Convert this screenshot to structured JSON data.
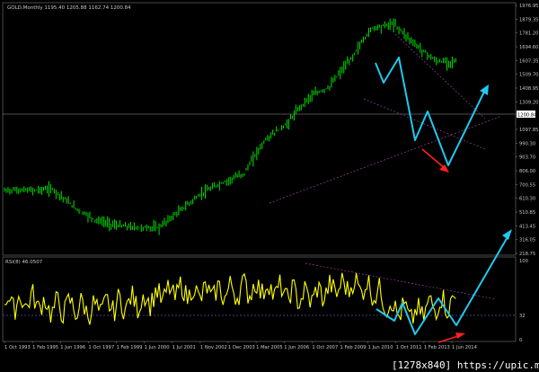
{
  "colors": {
    "background": "#000000",
    "price": "#00e000",
    "rsi": "#ffff00",
    "trendline": "#a040a0",
    "level": "#7f7fff",
    "cyan_arrow": "#22c8ee",
    "red_arrow": "#ff2020",
    "hline": "#a0a0a0"
  },
  "header": {
    "symbol_line": "GOLD,Monthly  1195.40 1205.88 1162.74 1200.84"
  },
  "rsi_panel": {
    "label": "RSI(8) 46.0507",
    "level_label": "32"
  },
  "watermark": "[1278x840] https://upic.me/",
  "chart_data": [
    {
      "type": "line",
      "title": "GOLD,Monthly  1195.40 1205.88 1162.74 1200.84",
      "y_tick_labels": [
        "1976.95",
        "1879.35",
        "1781.20",
        "1694.60",
        "1607.35",
        "1509.70",
        "1408.95",
        "1309.20",
        "1200.84",
        "1097.85",
        "990.30",
        "903.70",
        "806.00",
        "700.55",
        "610.30",
        "510.85",
        "413.45",
        "316.05",
        "218.75"
      ],
      "last_price": 1200.84,
      "series": [
        {
          "x": [
            1993,
            1994,
            1995,
            1996,
            1997,
            1998,
            1999,
            2000,
            2001,
            2002,
            2003,
            2004,
            2005,
            2006,
            2007,
            2008,
            2009,
            2010,
            2011,
            2012,
            2013,
            2014
          ],
          "values": [
            372,
            384,
            383,
            388,
            330,
            295,
            280,
            275,
            275,
            320,
            372,
            410,
            445,
            600,
            690,
            870,
            960,
            1225,
            1620,
            1680,
            1400,
            1200
          ]
        }
      ]
    },
    {
      "type": "line",
      "title": "RSI(8) 46.0507",
      "y_tick_labels": [
        "100",
        "32",
        "0"
      ],
      "levels": [
        32
      ],
      "series": [
        {
          "x": [
            1993,
            1994,
            1995,
            1996,
            1997,
            1998,
            1999,
            2000,
            2001,
            2002,
            2003,
            2004,
            2005,
            2006,
            2007,
            2008,
            2009,
            2010,
            2011,
            2012,
            2013,
            2014
          ],
          "values": [
            60,
            45,
            50,
            40,
            42,
            38,
            44,
            48,
            55,
            62,
            58,
            60,
            64,
            66,
            58,
            54,
            62,
            70,
            64,
            40,
            30,
            46
          ]
        }
      ]
    },
    {
      "type": "line",
      "x_tick_labels": [
        "1 Oct 1993",
        "1 Feb 1995",
        "1 Jun 1996",
        "1 Oct 1997",
        "1 Feb 1999",
        "1 Jun 2000",
        "1 Jul 2001",
        "1 Nov 2002",
        "1 Dec 2003",
        "1 Mar 2005",
        "1 Jun 2006",
        "1 Oct 2007",
        "1 Feb 2009",
        "1 Jun 2010",
        "1 Oct 2011",
        "1 Feb 2013",
        "1 Jun 2014"
      ]
    }
  ]
}
